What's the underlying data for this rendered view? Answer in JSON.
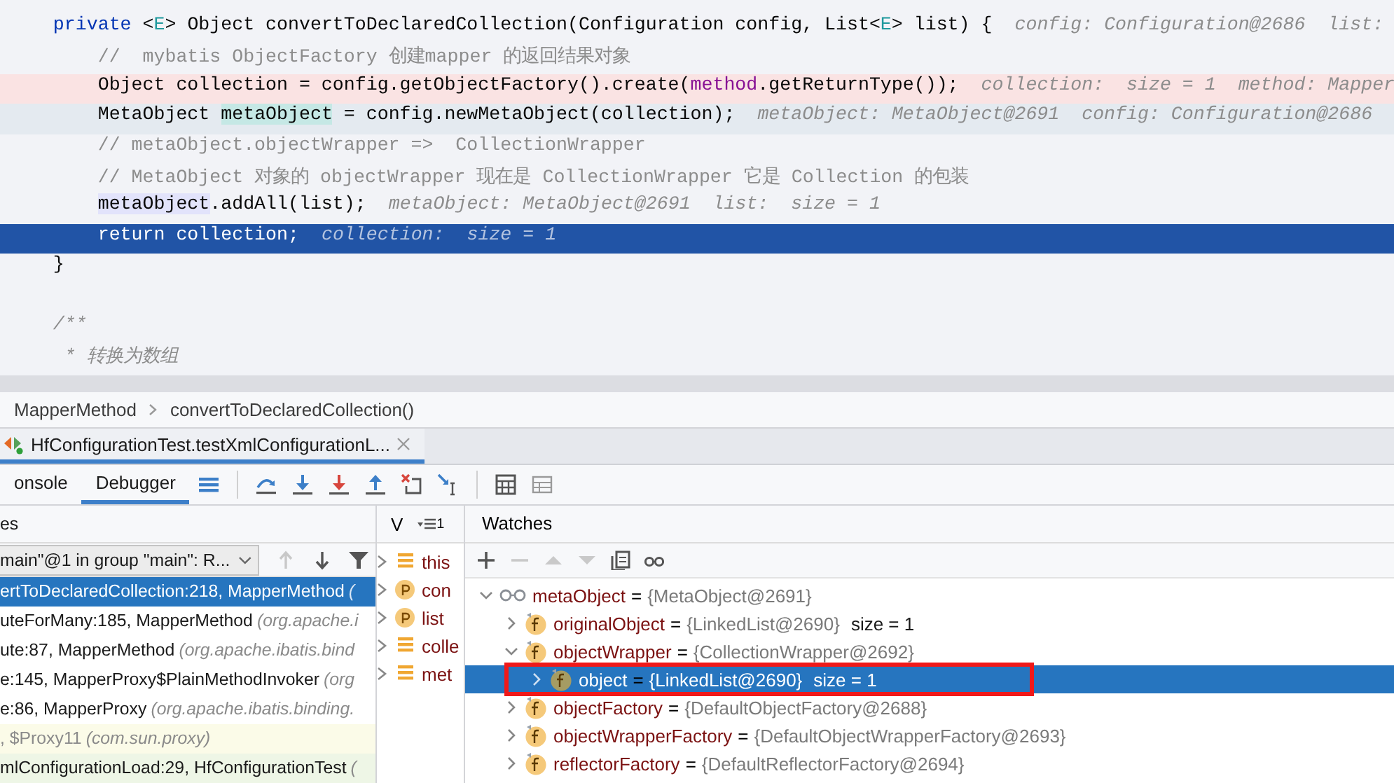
{
  "editor": {
    "lines": [
      {
        "kind": "plain",
        "segments": [
          {
            "text": "    private",
            "kind": "keyword"
          },
          {
            "text": " <",
            "kind": "plain"
          },
          {
            "text": "E",
            "kind": "type-param"
          },
          {
            "text": "> Object convertToDeclaredCollection(Configuration config, List<",
            "kind": "plain"
          },
          {
            "text": "E",
            "kind": "type-param"
          },
          {
            "text": "> list) {",
            "kind": "plain"
          }
        ],
        "hint": "config: Configuration@2686  list:"
      },
      {
        "kind": "plain",
        "segments": [
          {
            "text": "        //  mybatis ObjectFactory 创建mapper 的返回结果对象",
            "kind": "comment"
          }
        ]
      },
      {
        "kind": "breakpoint",
        "segments": [
          {
            "text": "        Object collection = config.getObjectFactory().create(",
            "kind": "plain"
          },
          {
            "text": "method",
            "kind": "field"
          },
          {
            "text": ".getReturnType());",
            "kind": "plain"
          }
        ],
        "hint": "collection:  size = 1  method: Mapper"
      },
      {
        "kind": "current",
        "segments": [
          {
            "text": "        MetaObject",
            "kind": "plain"
          },
          {
            "text": " metaObject",
            "kind": "write-usage"
          },
          {
            "text": " = config.newMetaObject(collection);",
            "kind": "plain"
          }
        ],
        "hint": "metaObject: MetaObject@2691  config: Configuration@2686"
      },
      {
        "kind": "plain",
        "segments": [
          {
            "text": "        // metaObject.objectWrapper =>  CollectionWrapper",
            "kind": "comment"
          }
        ]
      },
      {
        "kind": "plain",
        "segments": [
          {
            "text": "        // MetaObject 对象的 objectWrapper 现在是 CollectionWrapper 它是 Collection 的包装",
            "kind": "comment"
          }
        ]
      },
      {
        "kind": "plain",
        "segments": [
          {
            "text": "        metaObject",
            "kind": "usage"
          },
          {
            "text": ".addAll(list);",
            "kind": "plain"
          }
        ],
        "hint": "metaObject: MetaObject@2691  list:  size = 1"
      },
      {
        "kind": "execution",
        "segments": [
          {
            "text": "        return collection;",
            "kind": "plain"
          }
        ],
        "hint": "collection:  size = 1"
      },
      {
        "kind": "plain",
        "segments": [
          {
            "text": "    }",
            "kind": "plain"
          }
        ]
      },
      {
        "kind": "plain"
      },
      {
        "kind": "plain",
        "segments": [
          {
            "text": "    /**",
            "kind": "doc"
          }
        ]
      },
      {
        "kind": "plain",
        "segments": [
          {
            "text": "     * 转换为数组",
            "kind": "doc"
          }
        ]
      }
    ]
  },
  "breadcrumb": [
    "MapperMethod",
    "convertToDeclaredCollection()"
  ],
  "run_tabs": [
    {
      "label": "HfConfigurationTest.testXmlConfigurationL...",
      "selected": true
    }
  ],
  "debug_tabs": [
    {
      "label": "onsole",
      "selected": false
    },
    {
      "label": "Debugger",
      "selected": true
    }
  ],
  "frames": {
    "header": "es",
    "thread": "main\"@1 in group \"main\": R...",
    "nav": [
      {
        "disabled": true
      },
      {
        "disabled": false
      }
    ],
    "items": [
      {
        "method": "ertToDeclaredCollection:218, MapperMethod",
        "package": "(",
        "kind": "app",
        "selected": true
      },
      {
        "method": "uteForMany:185, MapperMethod",
        "package": "(org.apache.i",
        "kind": "app",
        "selected": false
      },
      {
        "method": "ute:87, MapperMethod",
        "package": "(org.apache.ibatis.bind",
        "kind": "app",
        "selected": false
      },
      {
        "method": "e:145, MapperProxy$PlainMethodInvoker",
        "package": "(org",
        "kind": "app",
        "selected": false
      },
      {
        "method": "e:86, MapperProxy",
        "package": "(org.apache.ibatis.binding.",
        "kind": "app",
        "selected": false
      },
      {
        "method": ", $Proxy11",
        "package": "(com.sun.proxy)",
        "kind": "library",
        "selected": false
      },
      {
        "method": "mlConfigurationLoad:29, HfConfigurationTest",
        "package": "(",
        "kind": "test",
        "selected": false
      }
    ]
  },
  "variables": {
    "header": "V",
    "sort_badge": "1",
    "items": [
      {
        "name": "this",
        "kind": "local"
      },
      {
        "name": "con",
        "kind": "param"
      },
      {
        "name": "list",
        "kind": "param"
      },
      {
        "name": "colle",
        "kind": "local"
      },
      {
        "name": "met",
        "kind": "local"
      }
    ]
  },
  "watches": {
    "header": "Watches",
    "toolbar": [
      {
        "disabled": false
      },
      {
        "disabled": true
      },
      {
        "disabled": true
      },
      {
        "disabled": true
      },
      {
        "disabled": false
      },
      {
        "disabled": false
      }
    ],
    "items": [
      {
        "kind": "watch",
        "name": "metaObject",
        "operator": "=",
        "value": "{MetaObject@2691}",
        "expanded": true,
        "selected": false,
        "children": [
          {
            "kind": "field",
            "name": "originalObject",
            "operator": "=",
            "value": "{LinkedList@2690}",
            "extra": "size = 1",
            "expanded": false,
            "selected": false
          },
          {
            "kind": "field",
            "name": "objectWrapper",
            "operator": "=",
            "value": "{CollectionWrapper@2692}",
            "expanded": true,
            "selected": false,
            "children": [
              {
                "kind": "field",
                "name": "object",
                "operator": "=",
                "value": "{LinkedList@2690}",
                "extra": "size = 1",
                "expanded": false,
                "selected": true,
                "boxed": true
              }
            ]
          },
          {
            "kind": "field",
            "name": "objectFactory",
            "operator": "=",
            "value": "{DefaultObjectFactory@2688}",
            "expanded": false,
            "selected": false
          },
          {
            "kind": "field",
            "name": "objectWrapperFactory",
            "operator": "=",
            "value": "{DefaultObjectWrapperFactory@2693}",
            "expanded": false,
            "selected": false
          },
          {
            "kind": "field",
            "name": "reflectorFactory",
            "operator": "=",
            "value": "{DefaultReflectorFactory@2694}",
            "expanded": false,
            "selected": false
          }
        ]
      }
    ]
  }
}
